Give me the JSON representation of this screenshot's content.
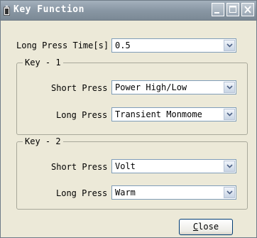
{
  "window": {
    "title": "Key Function"
  },
  "long_press_time": {
    "label": "Long Press Time[s]",
    "value": "0.5"
  },
  "key1": {
    "legend": "Key - 1",
    "short_press": {
      "label": "Short Press",
      "value": "Power High/Low"
    },
    "long_press": {
      "label": "Long Press",
      "value": "Transient Monmome"
    }
  },
  "key2": {
    "legend": "Key - 2",
    "short_press": {
      "label": "Short Press",
      "value": "Volt"
    },
    "long_press": {
      "label": "Long Press",
      "value": "Warm"
    }
  },
  "close_button": {
    "mnemonic": "C",
    "rest": "lose"
  },
  "icons": {
    "title": "battery-icon",
    "minimize": "minimize-icon",
    "maximize": "maximize-icon",
    "close": "close-icon",
    "dropdown": "chevron-down-icon"
  },
  "colors": {
    "titlebar": "#8997a4",
    "client_bg": "#ece9d8",
    "combo_border": "#7f9db9"
  }
}
